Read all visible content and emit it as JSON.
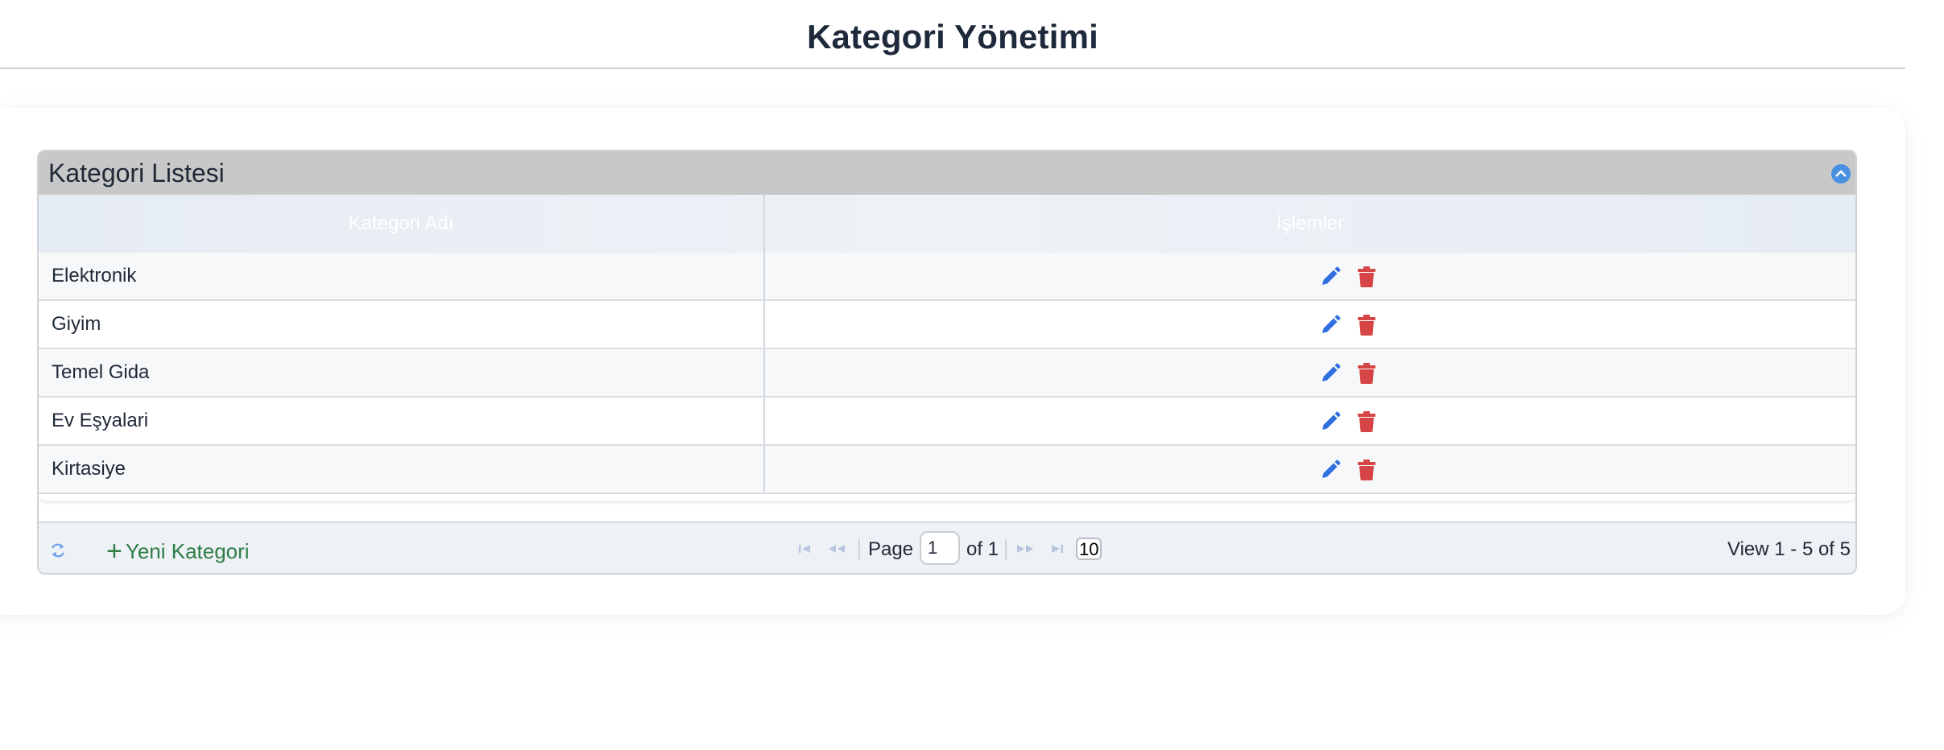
{
  "page": {
    "title": "Kategori Yönetimi"
  },
  "grid": {
    "caption": "Kategori Listesi",
    "columns": [
      "Kategori Adı",
      "İşlemler"
    ],
    "rows": [
      {
        "name": "Elektronik"
      },
      {
        "name": "Giyim"
      },
      {
        "name": "Temel Gida"
      },
      {
        "name": "Ev Eşyalari"
      },
      {
        "name": "Kirtasiye"
      }
    ],
    "icons": {
      "collapse": "chevron-up-icon",
      "edit": "pencil-icon",
      "delete": "trash-icon",
      "refresh": "refresh-icon",
      "first": "first-page-icon",
      "prev": "prev-page-icon",
      "next": "next-page-icon",
      "last": "last-page-icon"
    },
    "colors": {
      "edit": "#2f6fe0",
      "delete": "#d64545",
      "add": "#2e7d46",
      "caption_bg": "#c8c8c8"
    }
  },
  "pager": {
    "add_label": "Yeni Kategori",
    "page_label": "Page",
    "page_value": "1",
    "of_label": "of 1",
    "page_size": "10",
    "view_info": "View 1 - 5 of 5"
  }
}
